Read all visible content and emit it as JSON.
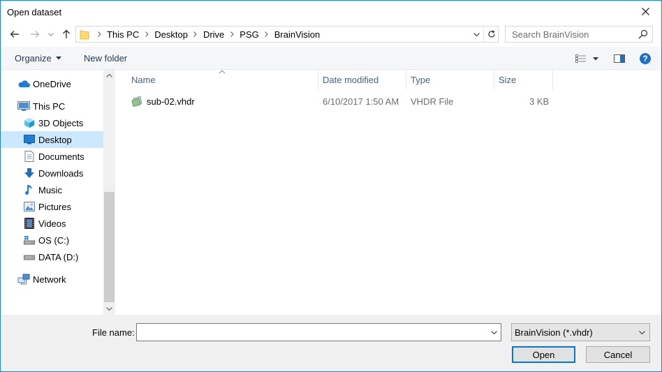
{
  "window": {
    "title": "Open dataset"
  },
  "address": {
    "breadcrumbs": [
      "This PC",
      "Desktop",
      "Drive",
      "PSG",
      "BrainVision"
    ]
  },
  "search": {
    "placeholder": "Search BrainVision"
  },
  "toolbar": {
    "organize_label": "Organize",
    "new_folder_label": "New folder"
  },
  "nav": {
    "items": [
      {
        "label": "OneDrive",
        "icon": "onedrive-cloud-icon"
      },
      {
        "label": "This PC",
        "icon": "computer-icon"
      },
      {
        "label": "3D Objects",
        "icon": "3d-objects-icon"
      },
      {
        "label": "Desktop",
        "icon": "desktop-icon",
        "selected": true
      },
      {
        "label": "Documents",
        "icon": "documents-icon"
      },
      {
        "label": "Downloads",
        "icon": "downloads-icon"
      },
      {
        "label": "Music",
        "icon": "music-icon"
      },
      {
        "label": "Pictures",
        "icon": "pictures-icon"
      },
      {
        "label": "Videos",
        "icon": "videos-icon"
      },
      {
        "label": "OS (C:)",
        "icon": "drive-os-icon"
      },
      {
        "label": "DATA (D:)",
        "icon": "drive-icon"
      },
      {
        "label": "Network",
        "icon": "network-icon"
      }
    ]
  },
  "columns": {
    "name": "Name",
    "date": "Date modified",
    "type": "Type",
    "size": "Size"
  },
  "files": [
    {
      "name": "sub-02.vhdr",
      "date": "6/10/2017 1:50 AM",
      "type": "VHDR File",
      "size": "3 KB"
    }
  ],
  "footer": {
    "filename_label": "File name:",
    "filename_value": "",
    "filter_selected": "BrainVision (*.vhdr)",
    "open_label": "Open",
    "cancel_label": "Cancel"
  },
  "colors": {
    "selection": "#cce8ff",
    "accent": "#0078d7",
    "help": "#1a70c9"
  }
}
